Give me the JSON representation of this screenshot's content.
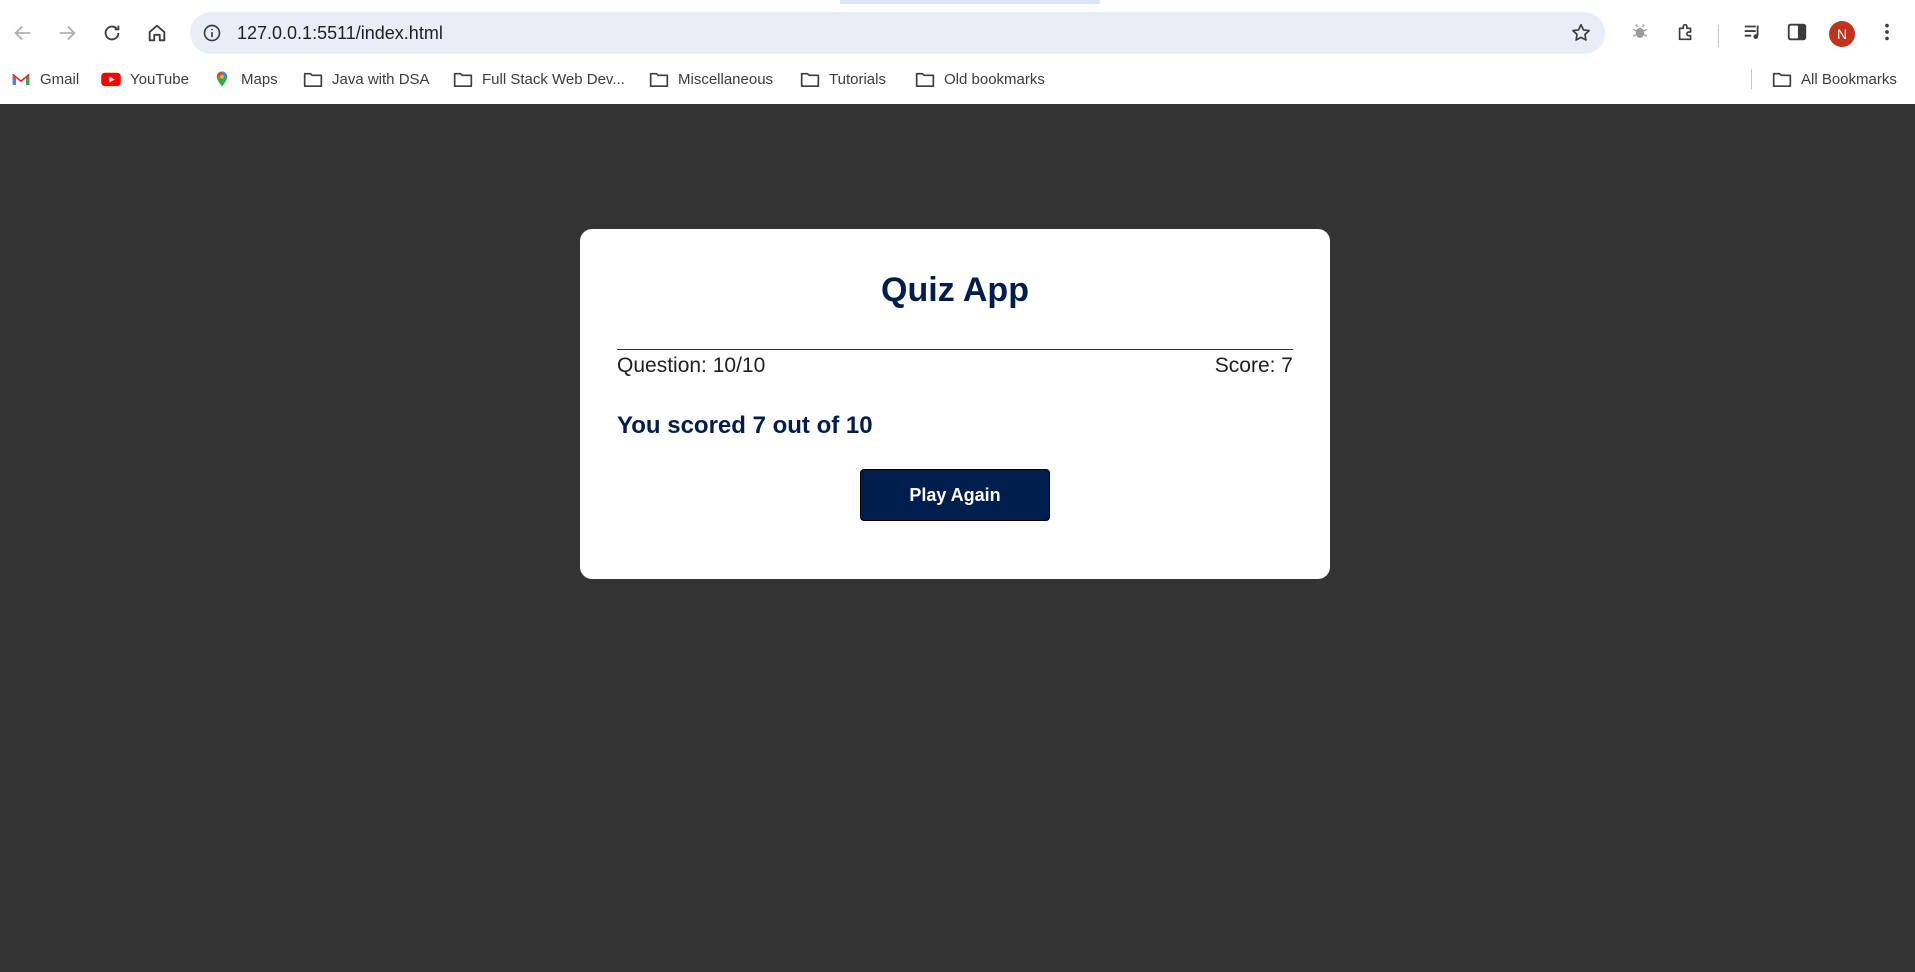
{
  "browser": {
    "url": "127.0.0.1:5511/index.html",
    "avatar_initial": "N",
    "bookmarks": [
      {
        "label": "Gmail",
        "icon": "gmail-icon"
      },
      {
        "label": "YouTube",
        "icon": "youtube-icon"
      },
      {
        "label": "Maps",
        "icon": "maps-icon"
      },
      {
        "label": "Java with DSA",
        "icon": "folder-icon"
      },
      {
        "label": "Full Stack Web Dev...",
        "icon": "folder-icon"
      },
      {
        "label": "Miscellaneous",
        "icon": "folder-icon"
      },
      {
        "label": "Tutorials",
        "icon": "folder-icon"
      },
      {
        "label": "Old bookmarks",
        "icon": "folder-icon"
      }
    ],
    "all_bookmarks_label": "All Bookmarks"
  },
  "quiz": {
    "title": "Quiz App",
    "question_counter": "Question: 10/10",
    "score_label": "Score: 7",
    "result_text": "You scored 7 out of 10",
    "play_again_label": "Play Again"
  },
  "colors": {
    "page_background": "#333333",
    "card_background": "#ffffff",
    "primary": "#001e4d",
    "avatar": "#c0341d"
  }
}
